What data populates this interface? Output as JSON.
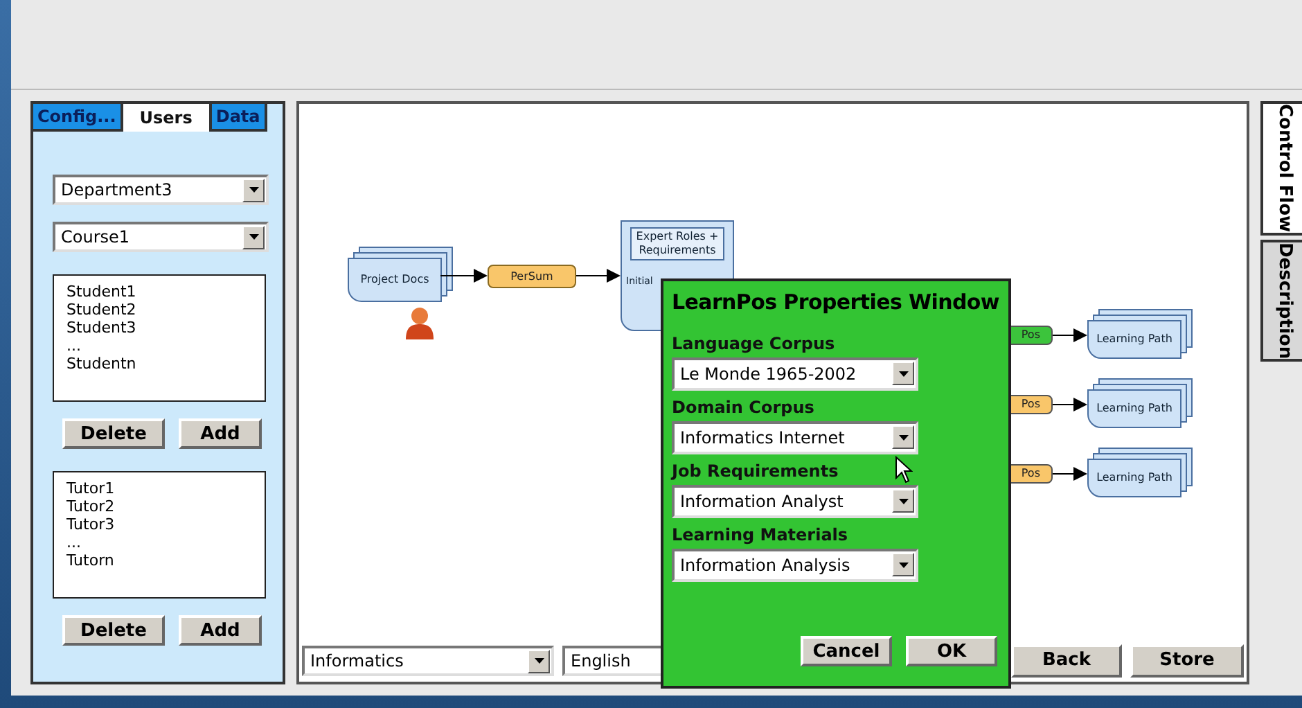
{
  "sidebar": {
    "tabs": [
      {
        "label": "Config...",
        "selected": false
      },
      {
        "label": "Users",
        "selected": true
      },
      {
        "label": "Data",
        "selected": false
      }
    ],
    "selects": [
      "Department3",
      "Course1"
    ],
    "lists": [
      {
        "items": [
          "Student1",
          "Student2",
          "Student3",
          "...",
          "Studentn"
        ],
        "buttons": [
          "Delete",
          "Add"
        ]
      },
      {
        "items": [
          "Tutor1",
          "Tutor2",
          "Tutor3",
          "...",
          "Tutorn"
        ],
        "buttons": [
          "Delete",
          "Add"
        ]
      }
    ]
  },
  "diagram": {
    "source": "Project Docs",
    "process": {
      "label": "PerSum",
      "color": "#f9c66a"
    },
    "requirements": {
      "label": "Expert Roles + Requirements",
      "caption": "Initial"
    },
    "outputs": [
      {
        "process": "Pos",
        "color": "#3cc43c",
        "target": "Learning Path"
      },
      {
        "process": "Pos",
        "color": "#f9c66a",
        "target": "Learning Path"
      },
      {
        "process": "Pos",
        "color": "#f9c66a",
        "target": "Learning Path"
      }
    ]
  },
  "bottom_bar": {
    "selects": [
      "Informatics",
      "English"
    ],
    "buttons": [
      "Back",
      "Store"
    ]
  },
  "side_tabs": [
    {
      "label": "Control Flow",
      "selected": true
    },
    {
      "label": "Description",
      "selected": false
    }
  ],
  "dialog": {
    "title": "LearnPos Properties Window",
    "fields": [
      {
        "label": "Language Corpus",
        "value": "Le Monde 1965-2002"
      },
      {
        "label": "Domain Corpus",
        "value": "Informatics Internet"
      },
      {
        "label": "Job Requirements",
        "value": "Information Analyst"
      },
      {
        "label": "Learning Materials",
        "value": "Information Analysis"
      }
    ],
    "buttons": [
      "Cancel",
      "OK"
    ]
  }
}
